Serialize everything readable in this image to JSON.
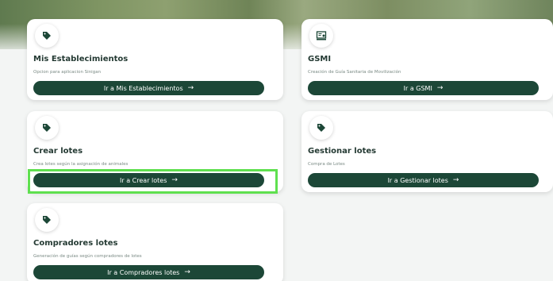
{
  "cards": [
    {
      "title": "Mis Establecimientos",
      "description": "Opcion para aplicacion Sinigan",
      "button_label": "Ir a Mis Establecimientos",
      "icon": "tag-icon"
    },
    {
      "title": "GSMI",
      "description": "Creación de Guía Sanitaria de Movilización",
      "button_label": "Ir a GSMI",
      "icon": "certificate-icon"
    },
    {
      "title": "Crear lotes",
      "description": "Crea lotes según la asignación de animales",
      "button_label": "Ir a Crear lotes",
      "icon": "tag-icon"
    },
    {
      "title": "Gestionar lotes",
      "description": "Compra de Lotes",
      "button_label": "Ir a Gestionar lotes",
      "icon": "tag-icon"
    },
    {
      "title": "Compradores lotes",
      "description": "Generación de guías según compradores de lotes",
      "button_label": "Ir a Compradores lotes",
      "icon": "tag-icon"
    }
  ],
  "arrow": "→",
  "colors": {
    "button": "#1c4737",
    "icon": "#1c4737",
    "highlight": "#5fe04f"
  }
}
